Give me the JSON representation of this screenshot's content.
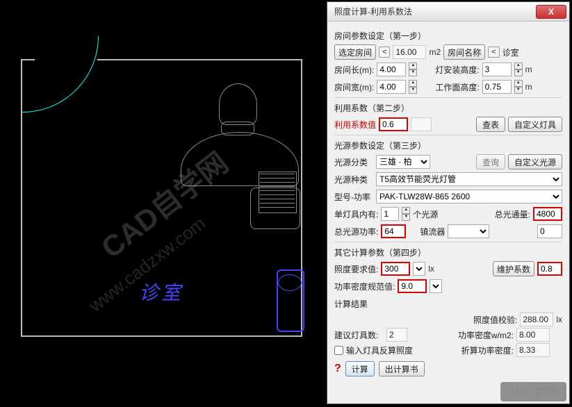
{
  "dialog": {
    "title": "照度计算-利用系数法",
    "close": "X"
  },
  "step1": {
    "heading": "房间参数设定（第一步）",
    "select_room_btn": "选定房间",
    "lt": "<",
    "area": "16.00",
    "area_unit": "m2",
    "room_name_btn": "房间名称",
    "room_name": "诊室",
    "room_len_label": "房间长(m):",
    "room_len": "4.00",
    "install_h_label": "灯安装高度:",
    "install_h": "3",
    "install_h_unit": "m",
    "room_w_label": "房间宽(m):",
    "room_w": "4.00",
    "work_h_label": "工作面高度:",
    "work_h": "0.75",
    "work_h_unit": "m"
  },
  "step2": {
    "heading": "利用系数（第二步）",
    "coef_label": "利用系数值",
    "coef_val": "0.6",
    "lookup_btn": "查表",
    "custom_lamp_btn": "自定义灯具"
  },
  "step3": {
    "heading": "光源参数设定（第三步）",
    "source_class_label": "光源分类",
    "source_class_val": "三雄 · 柏",
    "query_btn": "查询",
    "custom_src_btn": "自定义光源",
    "source_type_label": "光源种类",
    "source_type_val": "T5高效节能荧光灯管",
    "model_power_label": "型号-功率",
    "model_power_val": "PAK-TLW28W-865          2600",
    "per_lamp_label": "单灯具内有:",
    "per_lamp_val": "1",
    "per_lamp_unit": "个光源",
    "flux_label": "总光通量:",
    "flux_val": "4800",
    "total_power_label": "总光源功率:",
    "total_power_val": "64",
    "ballast_label": "镇流器",
    "ballast_val": "0"
  },
  "step4": {
    "heading": "其它计算参数（第四步）",
    "lux_req_label": "照度要求值:",
    "lux_req_val": "300",
    "lux_unit": "lx",
    "maint_label": "维护系数",
    "maint_val": "0.8",
    "density_label": "功率密度规范值:",
    "density_val": "9.0"
  },
  "results": {
    "heading": "计算结果",
    "suggest_label": "建议灯具数:",
    "suggest_val": "2",
    "lux_check_label": "照度值校验:",
    "lux_check_val": "288.00",
    "lux_check_unit": "lx",
    "pd_label": "功率密度w/m2:",
    "pd_val": "8.00",
    "input_lamp_chk": "输入灯具反算照度",
    "disc_pd_label": "折算功率密度:",
    "disc_pd_val": "8.33"
  },
  "footer": {
    "help": "?",
    "calc": "计算",
    "export": "出计算书",
    "brand": "CAD 自学网"
  },
  "cad": {
    "room_label": "诊室",
    "watermark": "CAD自学网",
    "watermark_url": "www.cadzxw.com"
  }
}
